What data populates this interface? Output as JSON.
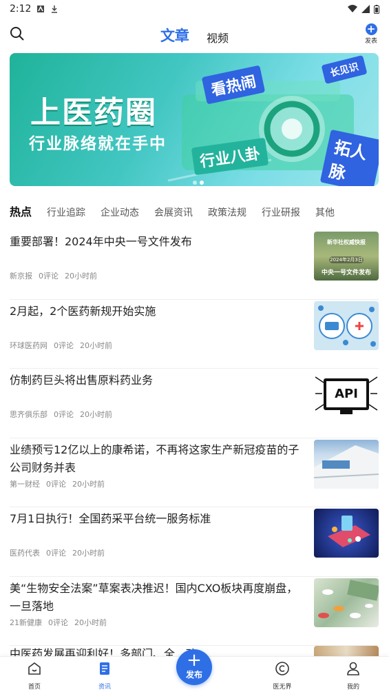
{
  "status_bar": {
    "time": "2:12"
  },
  "header": {
    "tabs": [
      {
        "label": "文章",
        "active": true
      },
      {
        "label": "视频",
        "active": false
      }
    ],
    "publish_label": "发表",
    "publish_symbol": "+"
  },
  "banner": {
    "title": "上医药圈",
    "subtitle": "行业脉络就在手中",
    "tags": [
      "看热闹",
      "长见识",
      "行业八卦",
      "拓人脉"
    ],
    "slide_count": 2,
    "active_slide": 2
  },
  "categories": [
    "热点",
    "行业追踪",
    "企业动态",
    "会展资讯",
    "政策法规",
    "行业研报",
    "其他"
  ],
  "news": [
    {
      "title": "重要部署！2024年中央一号文件发布",
      "source": "新京报",
      "comments": "0评论",
      "time": "20小时前",
      "thumb": {
        "line1": "新华社权威快报",
        "line2": "2024年2月3日",
        "line3": "中央一号文件发布"
      }
    },
    {
      "title": "2月起，2个医药新规开始实施",
      "source": "环球医药网",
      "comments": "0评论",
      "time": "20小时前"
    },
    {
      "title": "仿制药巨头将出售原料药业务",
      "source": "思齐俱乐部",
      "comments": "0评论",
      "time": "20小时前",
      "thumb_text": "API"
    },
    {
      "title": "业绩预亏12亿以上的康希诺，不再将这家生产新冠疫苗的子公司财务并表",
      "source": "第一财经",
      "comments": "0评论",
      "time": "20小时前"
    },
    {
      "title": "7月1日执行！全国药采平台统一服务标准",
      "source": "医药代表",
      "comments": "0评论",
      "time": "20小时前"
    },
    {
      "title": "美“生物安全法案”草案表决推迟！国内CXO板块再度崩盘，一旦落地",
      "source": "21新健康",
      "comments": "0评论",
      "time": "20小时前"
    }
  ],
  "partial_item": {
    "title": "中医药发展再迎利好！多部门、全...动"
  },
  "bottom_nav": [
    {
      "label": "首页",
      "icon": "home-icon",
      "active": false
    },
    {
      "label": "资讯",
      "icon": "document-icon",
      "active": true
    },
    {
      "label": "医无界",
      "icon": "circle-swirl-icon",
      "active": false
    },
    {
      "label": "我的",
      "icon": "user-icon",
      "active": false
    }
  ],
  "fab": {
    "label": "发布",
    "symbol": "+"
  },
  "colors": {
    "accent": "#2f6fe6",
    "banner_green": "#1fb39a"
  }
}
